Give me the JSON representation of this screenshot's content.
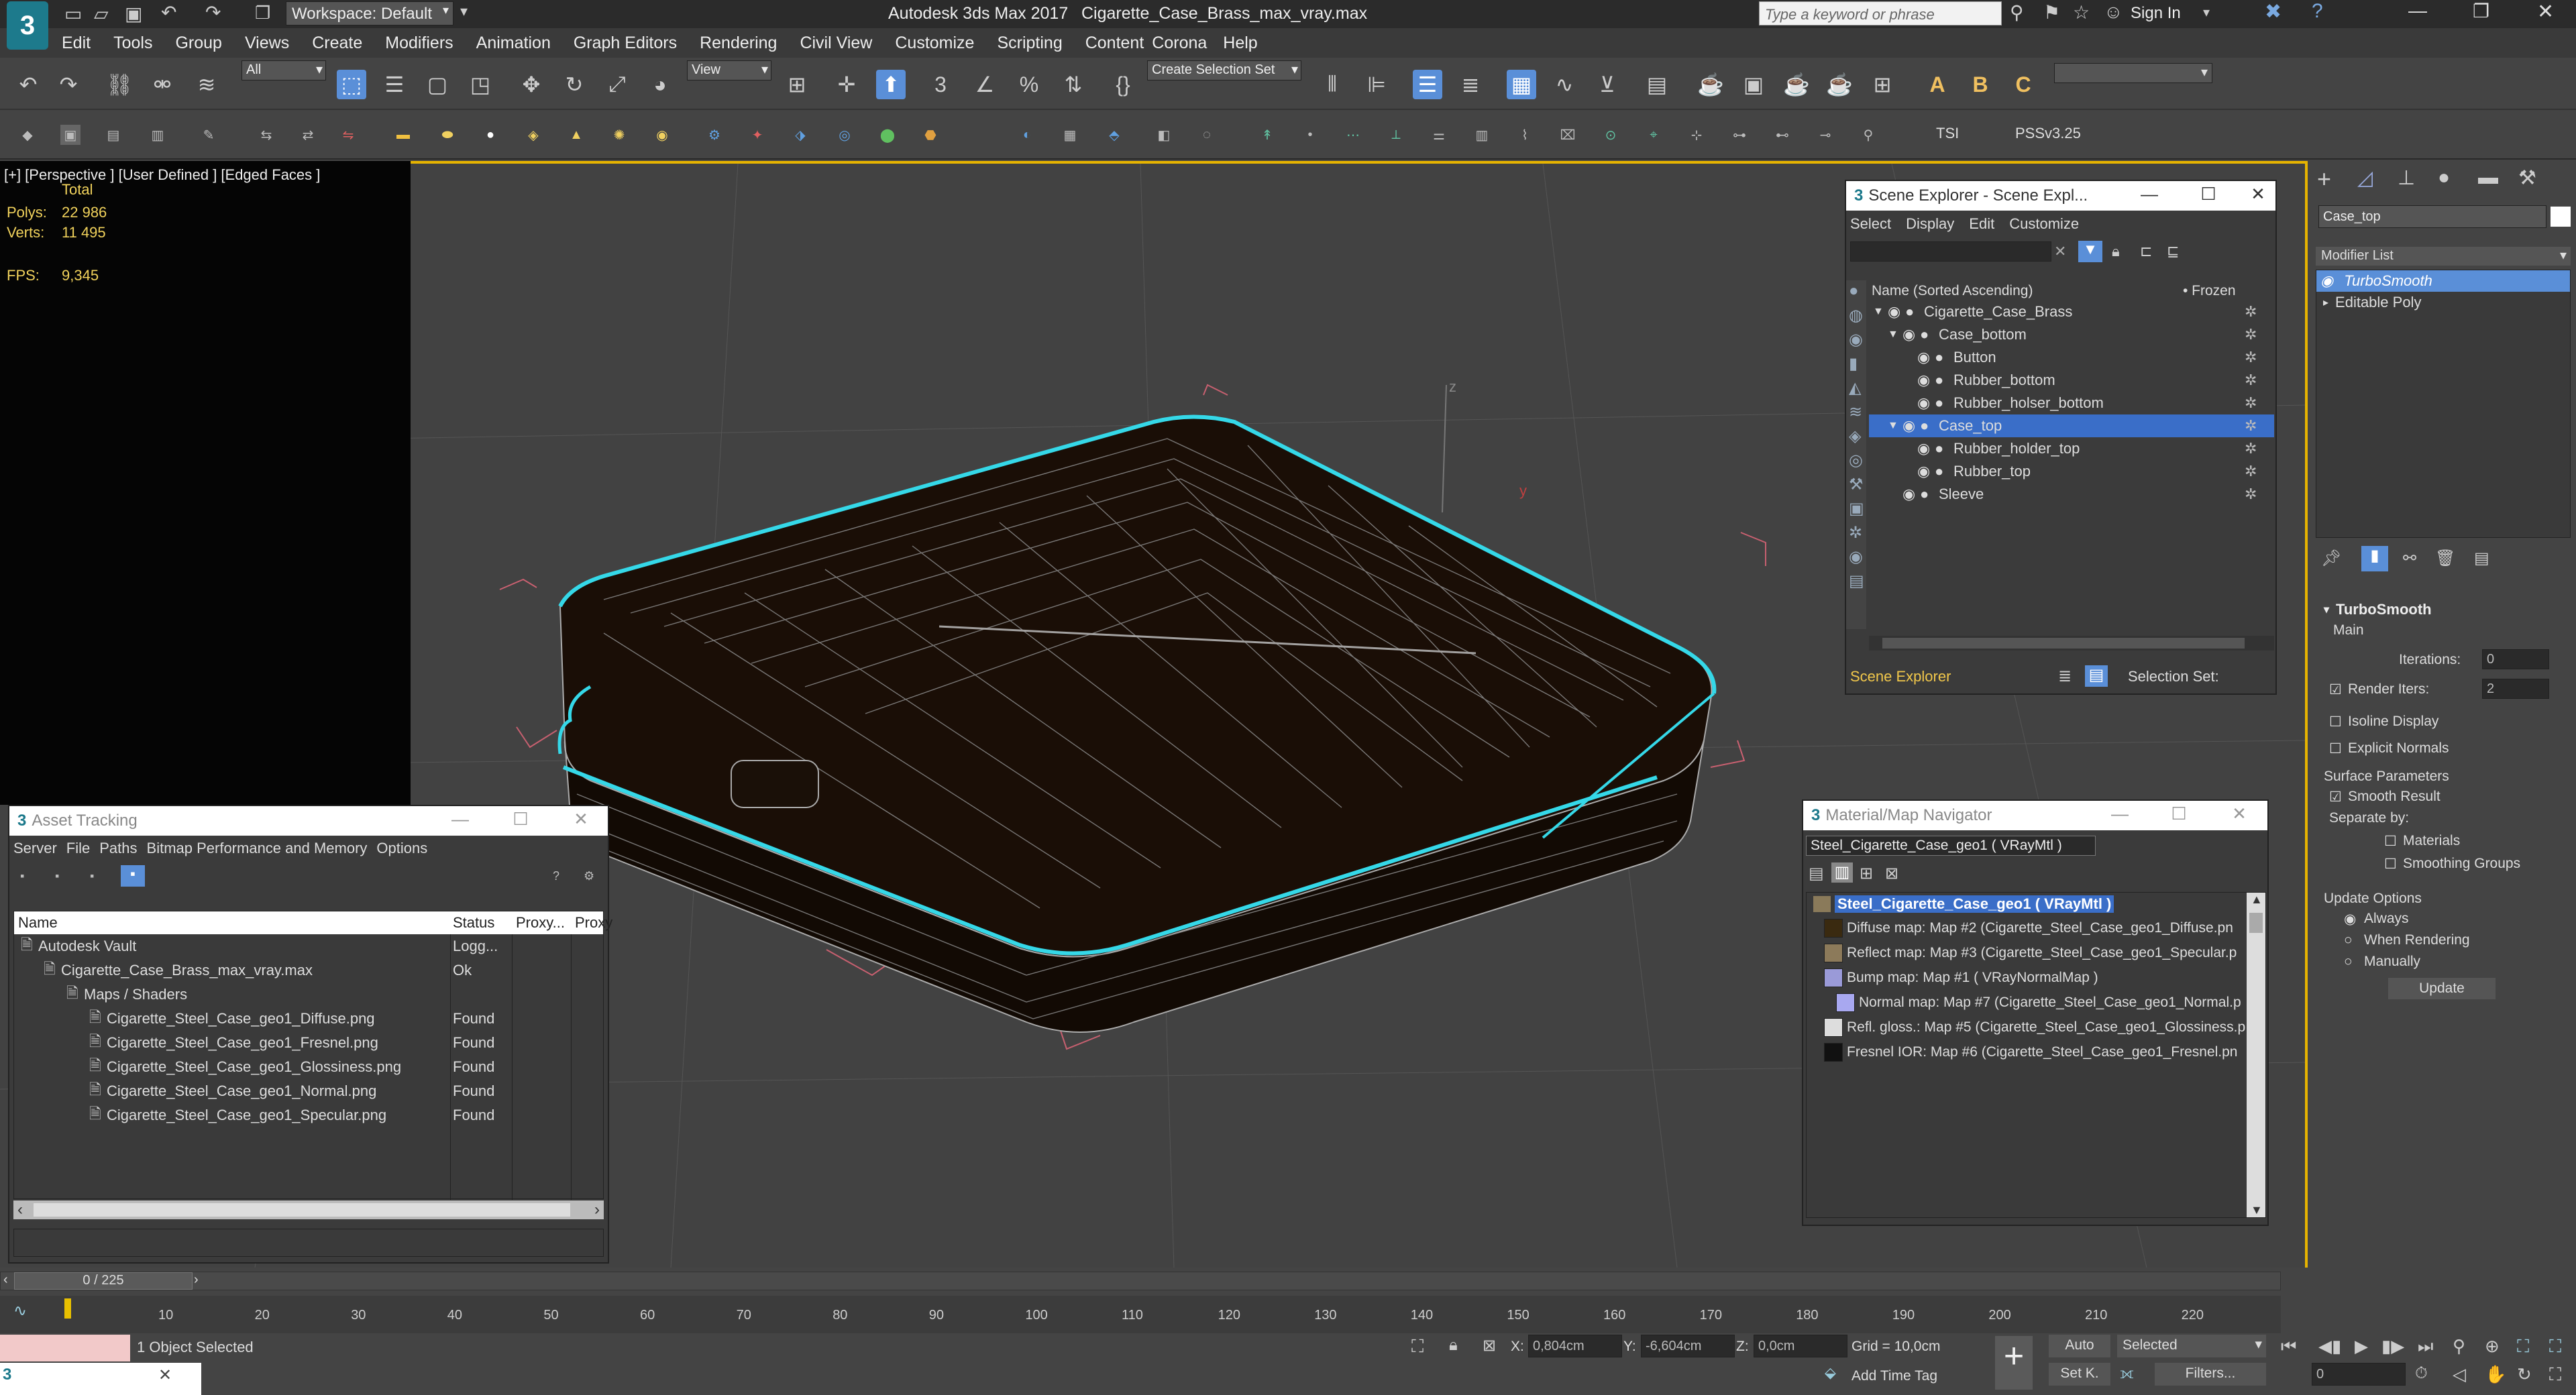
{
  "app": {
    "title": "Autodesk 3ds Max 2017",
    "file": "Cigarette_Case_Brass_max_vray.max",
    "workspace": "Workspace: Default",
    "search_placeholder": "Type a keyword or phrase",
    "sign_in": "Sign In"
  },
  "menu": [
    "Edit",
    "Tools",
    "Group",
    "Views",
    "Create",
    "Modifiers",
    "Animation",
    "Graph Editors",
    "Rendering",
    "Civil View",
    "Customize",
    "Scripting",
    "Content",
    "Corona",
    "Help"
  ],
  "toolbar": {
    "filter_value": "All",
    "view_value": "View",
    "selection_set": "Create Selection Set"
  },
  "ribbon": {
    "tsi": "TSI",
    "pss": "PSSv3.25"
  },
  "viewport": {
    "label": "[+] [Perspective ] [User Defined ] [Edged Faces ]",
    "stats_total": "Total",
    "polys_label": "Polys:",
    "polys_value": "22 986",
    "verts_label": "Verts:",
    "verts_value": "11 495",
    "fps_label": "FPS:",
    "fps_value": "9,345"
  },
  "scene_explorer": {
    "title": "Scene Explorer - Scene Expl...",
    "menu": [
      "Select",
      "Display",
      "Edit",
      "Customize"
    ],
    "col_name": "Name (Sorted Ascending)",
    "col_frozen": "• Frozen",
    "items": [
      {
        "name": "Cigarette_Case_Brass",
        "indent": 0,
        "arrow": "▼"
      },
      {
        "name": "Case_bottom",
        "indent": 1,
        "arrow": "▼"
      },
      {
        "name": "Button",
        "indent": 2,
        "arrow": ""
      },
      {
        "name": "Rubber_bottom",
        "indent": 2,
        "arrow": ""
      },
      {
        "name": "Rubber_holser_bottom",
        "indent": 2,
        "arrow": ""
      },
      {
        "name": "Case_top",
        "indent": 1,
        "arrow": "▼",
        "selected": true
      },
      {
        "name": "Rubber_holder_top",
        "indent": 2,
        "arrow": ""
      },
      {
        "name": "Rubber_top",
        "indent": 2,
        "arrow": ""
      },
      {
        "name": "Sleeve",
        "indent": 1,
        "arrow": ""
      }
    ],
    "footer": "Scene Explorer",
    "selection_set": "Selection Set:"
  },
  "asset_tracking": {
    "title": "Asset Tracking",
    "menu": [
      "Server",
      "File",
      "Paths",
      "Bitmap Performance and Memory",
      "Options"
    ],
    "columns": [
      "Name",
      "Status",
      "Proxy...",
      "Proxy"
    ],
    "rows": [
      {
        "name": "Autodesk Vault",
        "status": "Logg...",
        "indent": 0
      },
      {
        "name": "Cigarette_Case_Brass_max_vray.max",
        "status": "Ok",
        "indent": 1
      },
      {
        "name": "Maps / Shaders",
        "status": "",
        "indent": 2
      },
      {
        "name": "Cigarette_Steel_Case_geo1_Diffuse.png",
        "status": "Found",
        "indent": 3
      },
      {
        "name": "Cigarette_Steel_Case_geo1_Fresnel.png",
        "status": "Found",
        "indent": 3
      },
      {
        "name": "Cigarette_Steel_Case_geo1_Glossiness.png",
        "status": "Found",
        "indent": 3
      },
      {
        "name": "Cigarette_Steel_Case_geo1_Normal.png",
        "status": "Found",
        "indent": 3
      },
      {
        "name": "Cigarette_Steel_Case_geo1_Specular.png",
        "status": "Found",
        "indent": 3
      }
    ]
  },
  "material_nav": {
    "title": "Material/Map Navigator",
    "current": "Steel_Cigarette_Case_geo1  ( VRayMtl )",
    "root": "Steel_Cigarette_Case_geo1  ( VRayMtl )",
    "maps": [
      {
        "label": "Diffuse map: Map #2 (Cigarette_Steel_Case_geo1_Diffuse.pn",
        "color": "#3a2a10",
        "indent": 0
      },
      {
        "label": "Reflect map: Map #3 (Cigarette_Steel_Case_geo1_Specular.p",
        "color": "#8c7a5a",
        "indent": 0
      },
      {
        "label": "Bump map: Map #1  ( VRayNormalMap )",
        "color": "#9a9ad8",
        "indent": 0
      },
      {
        "label": "Normal map: Map #7 (Cigarette_Steel_Case_geo1_Normal.p",
        "color": "#a8a8f0",
        "indent": 1
      },
      {
        "label": "Refl. gloss.: Map #5 (Cigarette_Steel_Case_geo1_Glossiness.p",
        "color": "#dddddd",
        "indent": 0
      },
      {
        "label": "Fresnel IOR: Map #6 (Cigarette_Steel_Case_geo1_Fresnel.pn",
        "color": "#111111",
        "indent": 0
      }
    ]
  },
  "command_panel": {
    "object_name": "Case_top",
    "modifier_list": "Modifier List",
    "stack": [
      "TurboSmooth",
      "Editable Poly"
    ],
    "rollout_title": "TurboSmooth",
    "main": "Main",
    "iterations_label": "Iterations:",
    "iterations_value": "0",
    "render_iters_label": "Render Iters:",
    "render_iters_value": "2",
    "isoline": "Isoline Display",
    "explicit_normals": "Explicit Normals",
    "surface_params": "Surface Parameters",
    "smooth_result": "Smooth Result",
    "separate_by": "Separate by:",
    "materials": "Materials",
    "smoothing_groups": "Smoothing Groups",
    "update_options": "Update Options",
    "always": "Always",
    "when_rendering": "When Rendering",
    "manually": "Manually",
    "update_btn": "Update"
  },
  "timeline": {
    "frame": "0 / 225",
    "ticks": [
      "10",
      "20",
      "30",
      "40",
      "50",
      "60",
      "70",
      "80",
      "90",
      "100",
      "110",
      "120",
      "130",
      "140",
      "150",
      "160",
      "170",
      "180",
      "190",
      "200",
      "210",
      "220"
    ]
  },
  "status": {
    "selected": "1 Object Selected",
    "x_label": "X:",
    "x_value": "0,804cm",
    "y_label": "Y:",
    "y_value": "-6,604cm",
    "z_label": "Z:",
    "z_value": "0,0cm",
    "grid": "Grid = 10,0cm",
    "add_time_tag": "Add Time Tag",
    "auto": "Auto",
    "set_key": "Set K.",
    "selected_mode": "Selected",
    "filters": "Filters...",
    "frame_value": "0"
  }
}
